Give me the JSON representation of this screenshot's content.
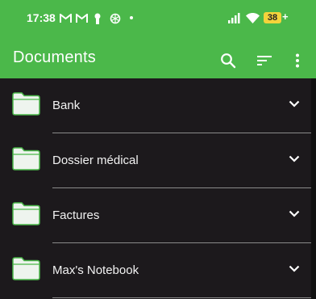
{
  "status": {
    "time": "17:38",
    "battery": "38",
    "icons": [
      "gmail-icon",
      "gmail-icon",
      "keyhole-icon",
      "openai-icon",
      "dot-icon",
      "signal-icon",
      "wifi-icon",
      "battery-icon"
    ]
  },
  "appbar": {
    "title": "Documents",
    "actions": [
      "search-icon",
      "sort-icon",
      "more-vert-icon"
    ]
  },
  "folders": [
    {
      "label": "Bank"
    },
    {
      "label": "Dossier médical"
    },
    {
      "label": "Factures"
    },
    {
      "label": "Max's Notebook"
    }
  ],
  "colors": {
    "accent": "#4bb84a",
    "background": "#1c191c",
    "folder_fill": "#eef4ee",
    "folder_stroke": "#4bb84a"
  }
}
